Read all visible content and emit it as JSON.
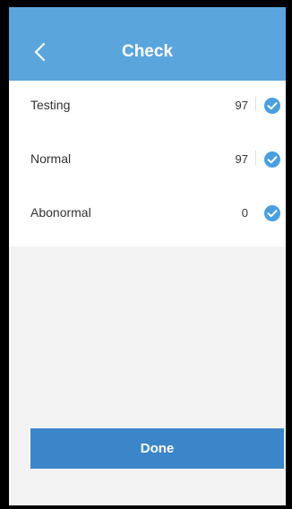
{
  "header": {
    "title": "Check",
    "back_icon": "chevron-left-icon"
  },
  "rows": [
    {
      "label": "Testing",
      "value": "97",
      "icon": "check-circle-icon"
    },
    {
      "label": "Normal",
      "value": "97",
      "icon": "check-circle-icon"
    },
    {
      "label": "Abonormal",
      "value": "0",
      "icon": "check-circle-icon"
    }
  ],
  "actions": {
    "done_label": "Done"
  },
  "colors": {
    "header": "#5aa5dc",
    "button": "#3b86c9",
    "check": "#4a9fe0"
  }
}
